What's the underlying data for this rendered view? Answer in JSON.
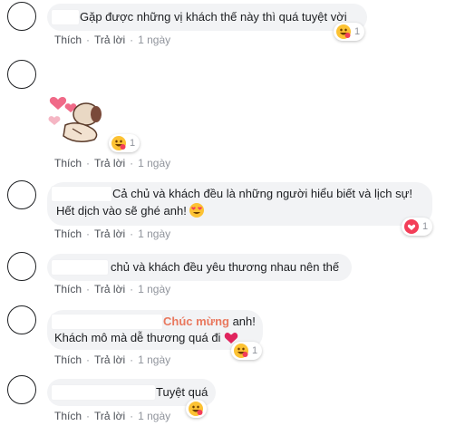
{
  "comments": [
    {
      "text": "Gặp được những vị khách thế này thì quá tuyệt vời",
      "reaction_count": "1"
    },
    {
      "sticker": "hearts-sticker",
      "reaction_count": "1"
    },
    {
      "line1": "Cả chủ và khách đều là những người hiểu biết và lịch sự!",
      "line2": "Hết dịch vào sẽ ghé anh!",
      "reaction_count": "1"
    },
    {
      "text": "chủ và khách đều yêu thương nhau nên thế"
    },
    {
      "highlight": "Chúc mừng",
      "line1_rest": " anh!",
      "line2": "Khách mô mà dễ thương quá đi",
      "reaction_count": "1"
    },
    {
      "text": "Tuyệt quá"
    }
  ],
  "actions": {
    "like": "Thích",
    "reply": "Trả lời",
    "time": "1 ngày",
    "sep": "·"
  },
  "colors": {
    "highlight": "#e9785e",
    "bubble": "#f2f3f5",
    "love": "#f33e58",
    "haha": "#fcc233"
  },
  "icons": [
    "haha-reaction-icon",
    "love-reaction-icon",
    "heart-eyes-emoji",
    "red-heart-emoji"
  ]
}
